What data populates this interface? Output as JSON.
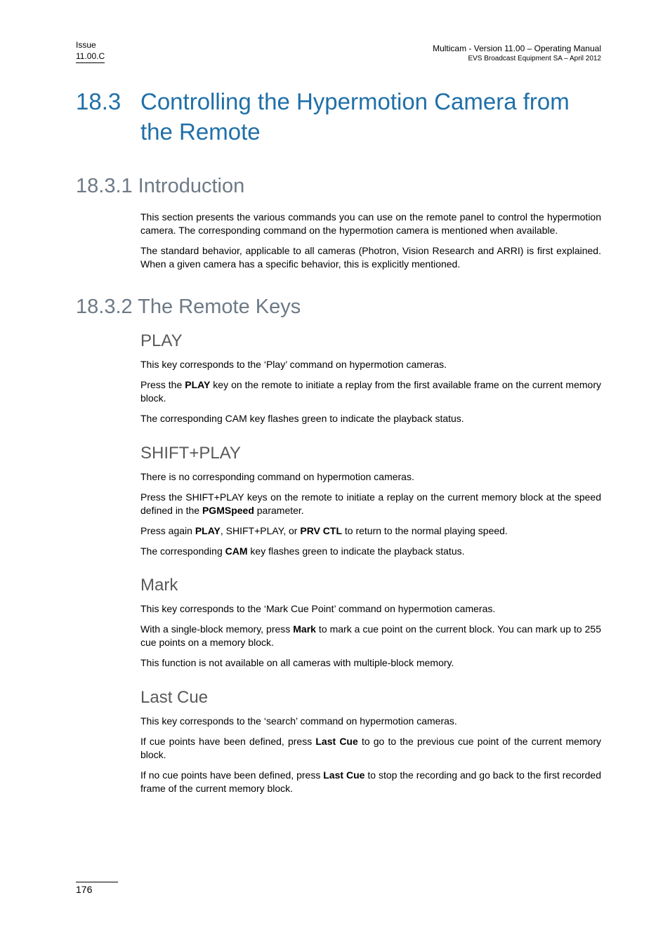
{
  "header": {
    "left_line1": "Issue",
    "left_line2": "11.00.C",
    "right_line1": "Multicam - Version 11.00 – Operating Manual",
    "right_line2": "EVS Broadcast Equipment SA – April 2012"
  },
  "section": {
    "number": "18.3",
    "title": "Controlling the Hypermotion Camera from the Remote"
  },
  "sub1": {
    "heading": "18.3.1 Introduction",
    "p1": "This section presents the various commands you can use on the remote panel to control the hypermotion camera. The corresponding command on the hypermotion camera is mentioned when available.",
    "p2": "The standard behavior, applicable to all cameras (Photron, Vision Research and ARRI) is first explained. When a given camera has a specific behavior, this is explicitly mentioned."
  },
  "sub2": {
    "heading": "18.3.2 The Remote Keys",
    "play": {
      "title": "PLAY",
      "p1": "This key corresponds to the ‘Play’ command on hypermotion cameras.",
      "p2a": "Press the ",
      "p2b": "PLAY",
      "p2c": " key on the remote to initiate a replay from the first available frame on the current memory block.",
      "p3": "The corresponding CAM key flashes green to indicate the playback status."
    },
    "shiftplay": {
      "title": "SHIFT+PLAY",
      "p1": "There is no corresponding command on hypermotion cameras.",
      "p2a": "Press the SHIFT+PLAY keys on the remote to initiate a replay on the current memory block at the speed defined in the ",
      "p2b": "PGMSpeed",
      "p2c": " parameter.",
      "p3a": "Press again ",
      "p3b": "PLAY",
      "p3c": ", SHIFT+PLAY, or ",
      "p3d": "PRV CTL",
      "p3e": " to return to the normal playing speed.",
      "p4a": "The corresponding ",
      "p4b": "CAM",
      "p4c": " key flashes green to indicate the playback status."
    },
    "mark": {
      "title": "Mark",
      "p1": "This key corresponds to the ‘Mark Cue Point’ command on hypermotion cameras.",
      "p2a": "With a single-block memory, press ",
      "p2b": "Mark",
      "p2c": " to mark a cue point on the current block. You can mark up to 255 cue points on a memory block.",
      "p3": "This function is not available on all cameras with multiple-block memory."
    },
    "lastcue": {
      "title": "Last Cue",
      "p1": "This key corresponds to the ‘search’ command on hypermotion cameras.",
      "p2a": "If cue points have been defined, press ",
      "p2b": "Last Cue",
      "p2c": " to go to the previous cue point of the current memory block.",
      "p3a": "If no cue points have been defined, press ",
      "p3b": "Last Cue",
      "p3c": " to stop the recording and go back to the first recorded frame of the current memory block."
    }
  },
  "footer": {
    "page": "176"
  }
}
